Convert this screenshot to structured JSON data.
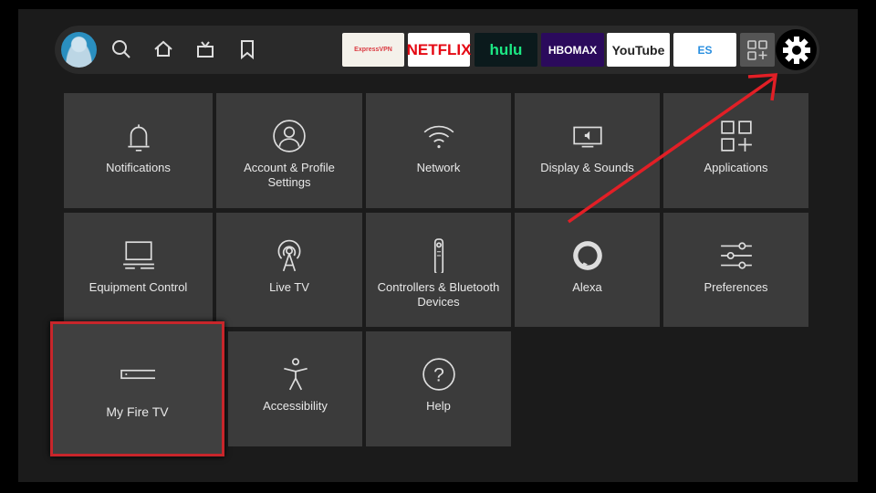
{
  "nav": {
    "icons": [
      "avatar",
      "search-icon",
      "home-icon",
      "live-tv-icon",
      "bookmark-icon"
    ]
  },
  "apps": [
    {
      "label": "ExpressVPN",
      "bg": "#f4f1ea",
      "fg": "#da3940"
    },
    {
      "label": "NETFLIX",
      "bg": "#ffffff",
      "fg": "#e50914"
    },
    {
      "label": "hulu",
      "bg": "#0b1a1c",
      "fg": "#1ce783"
    },
    {
      "label": "HBOMAX",
      "bg": "#2b0a5c",
      "fg": "#ffffff"
    },
    {
      "label": "YouTube",
      "bg": "#ffffff",
      "fg": "#222222"
    },
    {
      "label": "ES",
      "bg": "#ffffff",
      "fg": "#2a8fe0"
    }
  ],
  "tiles": [
    {
      "label": "Notifications",
      "icon": "bell-icon"
    },
    {
      "label": "Account & Profile Settings",
      "icon": "user-icon"
    },
    {
      "label": "Network",
      "icon": "wifi-icon"
    },
    {
      "label": "Display & Sounds",
      "icon": "display-icon"
    },
    {
      "label": "Applications",
      "icon": "apps-grid-icon"
    },
    {
      "label": "Equipment Control",
      "icon": "tv-equipment-icon"
    },
    {
      "label": "Live TV",
      "icon": "antenna-icon"
    },
    {
      "label": "Controllers & Bluetooth Devices",
      "icon": "remote-icon"
    },
    {
      "label": "Alexa",
      "icon": "alexa-icon"
    },
    {
      "label": "Preferences",
      "icon": "sliders-icon"
    },
    {
      "label": "My Fire TV",
      "icon": "fire-tv-device-icon",
      "selected": true
    },
    {
      "label": "Accessibility",
      "icon": "accessibility-icon"
    },
    {
      "label": "Help",
      "icon": "help-icon"
    }
  ],
  "colors": {
    "annotation": "#e21f26",
    "selection": "#c8262b"
  }
}
